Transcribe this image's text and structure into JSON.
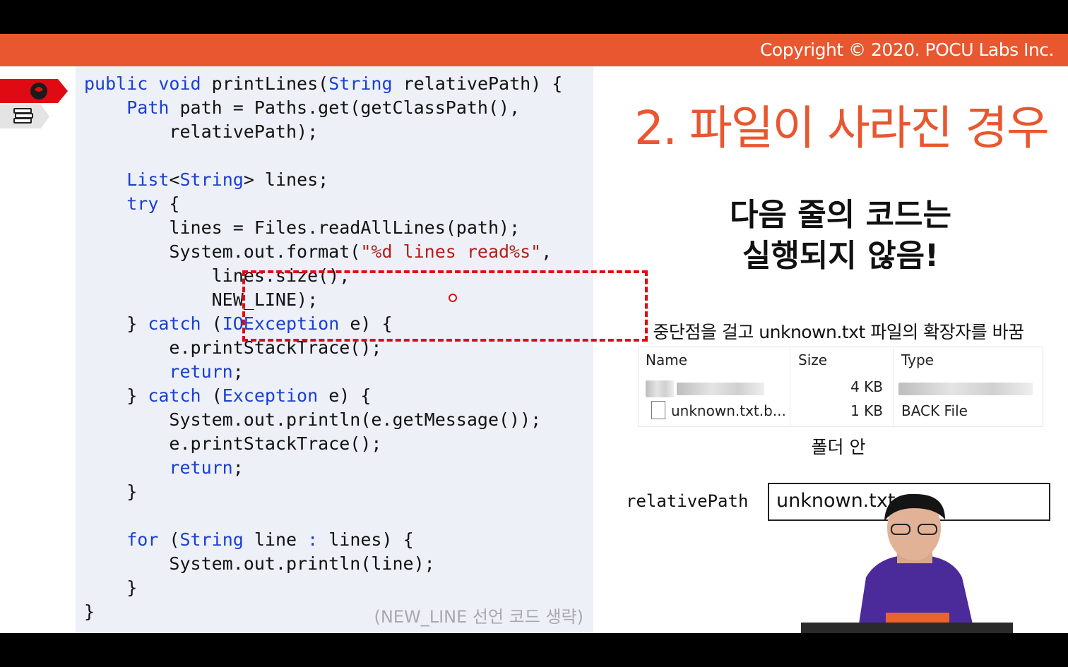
{
  "header": {
    "copyright": "Copyright © 2020. POCU Labs Inc."
  },
  "code": {
    "lines": [
      [
        [
          "kw",
          "public"
        ],
        [
          "p",
          " "
        ],
        [
          "kw",
          "void"
        ],
        [
          "p",
          " printLines("
        ],
        [
          "ty",
          "String"
        ],
        [
          "p",
          " relativePath) {"
        ]
      ],
      [
        [
          "p",
          "    "
        ],
        [
          "ty",
          "Path"
        ],
        [
          "p",
          " path = Paths.get(getClassPath(),"
        ]
      ],
      [
        [
          "p",
          "        relativePath);"
        ]
      ],
      [
        [
          "p",
          ""
        ]
      ],
      [
        [
          "p",
          "    "
        ],
        [
          "ty",
          "List"
        ],
        [
          "p",
          "<"
        ],
        [
          "ty",
          "String"
        ],
        [
          "p",
          "> lines;"
        ]
      ],
      [
        [
          "p",
          "    "
        ],
        [
          "kw",
          "try"
        ],
        [
          "p",
          " {"
        ]
      ],
      [
        [
          "p",
          "        lines = Files.readAllLines(path);"
        ]
      ],
      [
        [
          "p",
          "        System.out.format("
        ],
        [
          "str",
          "\"%d lines read%s\""
        ],
        [
          "p",
          ","
        ]
      ],
      [
        [
          "p",
          "            lines.size(),"
        ]
      ],
      [
        [
          "p",
          "            NEW_LINE);"
        ]
      ],
      [
        [
          "p",
          "    } "
        ],
        [
          "kw",
          "catch"
        ],
        [
          "p",
          " ("
        ],
        [
          "ty",
          "IOException"
        ],
        [
          "p",
          " e) {"
        ]
      ],
      [
        [
          "p",
          "        e.printStackTrace();"
        ]
      ],
      [
        [
          "p",
          "        "
        ],
        [
          "kw",
          "return"
        ],
        [
          "p",
          ";"
        ]
      ],
      [
        [
          "p",
          "    } "
        ],
        [
          "kw",
          "catch"
        ],
        [
          "p",
          " ("
        ],
        [
          "ty",
          "Exception"
        ],
        [
          "p",
          " e) {"
        ]
      ],
      [
        [
          "p",
          "        System.out.println(e.getMessage());"
        ]
      ],
      [
        [
          "p",
          "        e.printStackTrace();"
        ]
      ],
      [
        [
          "p",
          "        "
        ],
        [
          "kw",
          "return"
        ],
        [
          "p",
          ";"
        ]
      ],
      [
        [
          "p",
          "    }"
        ]
      ],
      [
        [
          "p",
          ""
        ]
      ],
      [
        [
          "p",
          "    "
        ],
        [
          "kw",
          "for"
        ],
        [
          "p",
          " ("
        ],
        [
          "ty",
          "String"
        ],
        [
          "p",
          " line "
        ],
        [
          "kw",
          ":"
        ],
        [
          "p",
          " lines) {"
        ]
      ],
      [
        [
          "p",
          "        System.out.println(line);"
        ]
      ],
      [
        [
          "p",
          "    }"
        ]
      ],
      [
        [
          "p",
          "}"
        ]
      ]
    ],
    "footnote": "(NEW_LINE 선언 코드 생략)"
  },
  "slide": {
    "title": "2. 파일이 사라진 경우",
    "headline_line1": "다음 줄의 코드는",
    "headline_line2": "실행되지 않음!",
    "caption": "중단점을 걸고 unknown.txt 파일의 확장자를 바꿈",
    "explorer": {
      "headers": {
        "name": "Name",
        "size": "Size",
        "type": "Type"
      },
      "rows": [
        {
          "size": "4 KB"
        },
        {
          "name": "unknown.txt.b...",
          "size": "1 KB",
          "type": "BACK File"
        }
      ]
    },
    "folder_label": "폴더 안",
    "relative_path_label": "relativePath",
    "relative_path_value": "unknown.txt"
  },
  "colors": {
    "accent": "#e8572f",
    "keyword": "#1a3fd0",
    "string": "#b0201a",
    "highlight_box": "#e00b12"
  },
  "icons": [
    "brain-head-icon",
    "books-stack-icon",
    "file-icon"
  ]
}
